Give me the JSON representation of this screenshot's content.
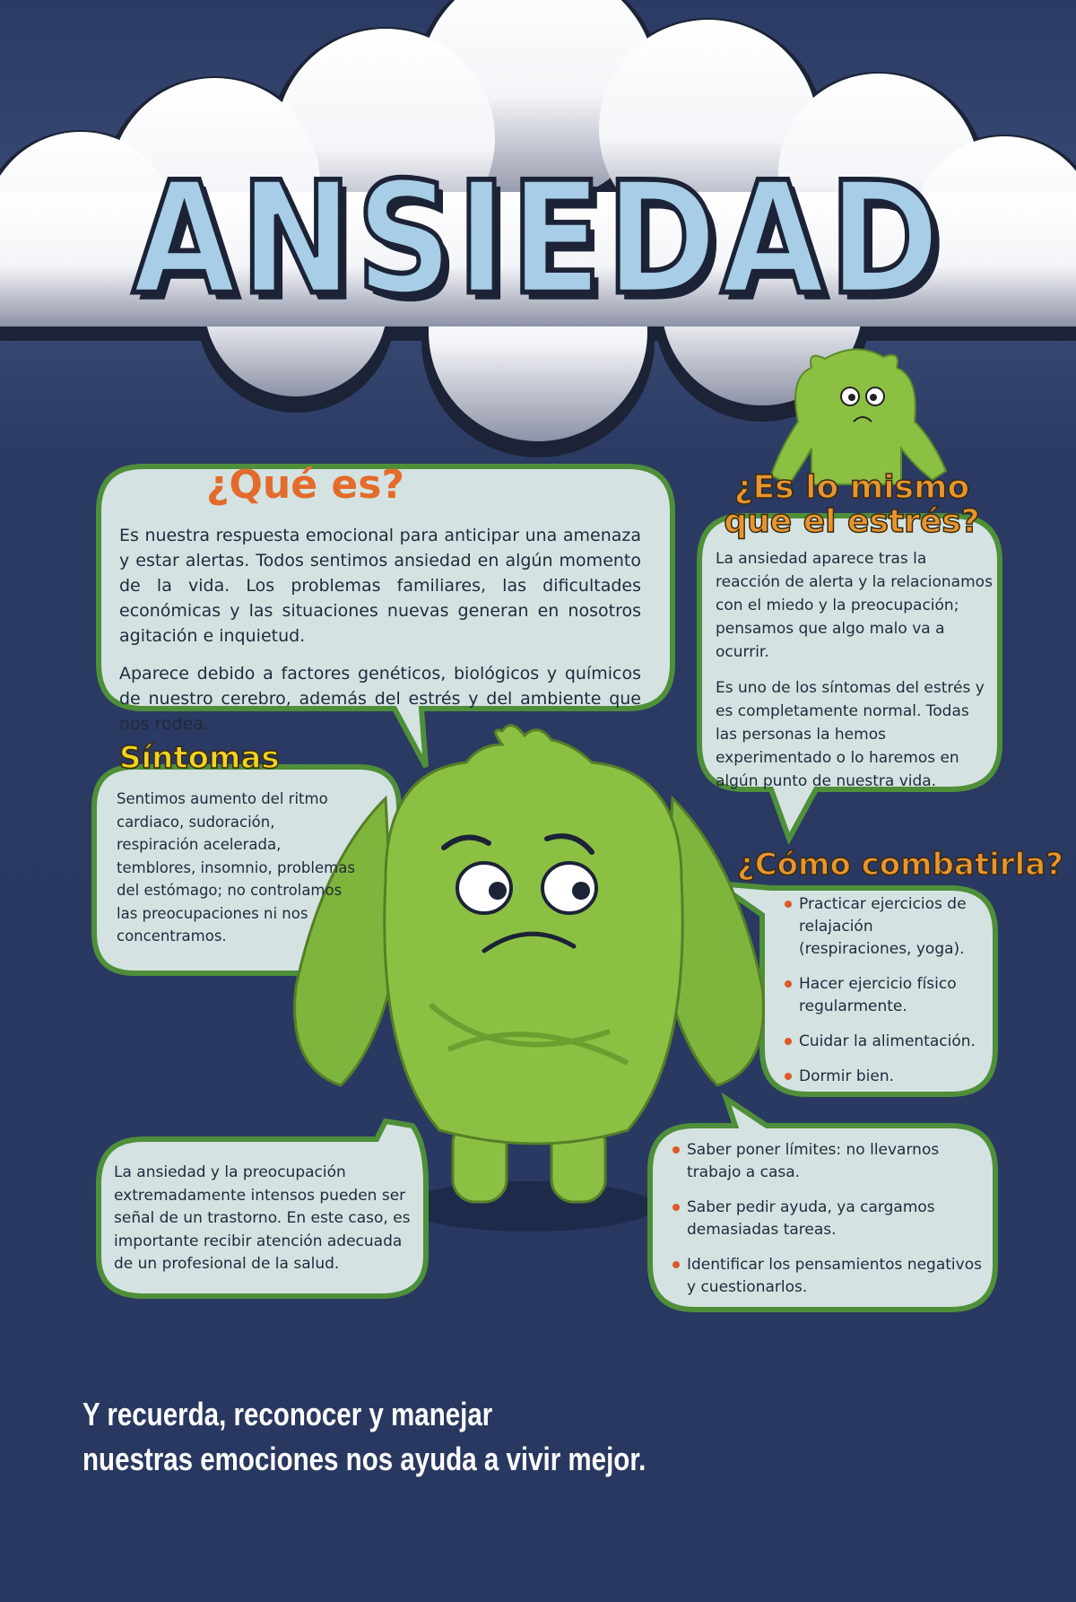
{
  "title": "ANSIEDAD",
  "que_es": {
    "heading": "¿Qué es?",
    "p1": "Es nuestra respuesta emocional para anticipar una amenaza y estar alertas. Todos sentimos ansiedad en algún momento de la vida. Los problemas familiares, las dificultades económicas y las situaciones nuevas generan en nosotros agitación e inquietud.",
    "p2": "Aparece debido a factores genéticos, biológicos y químicos de nuestro cerebro, además del estrés y del ambiente que nos rodea."
  },
  "estres": {
    "heading_line1": "¿Es lo mismo",
    "heading_line2": "que el estrés?",
    "p1": "La ansiedad aparece tras la reacción de alerta y la relacionamos con el miedo y la preocupación; pensamos que algo malo va a ocurrir.",
    "p2": "Es uno de los síntomas del estrés y es completamente normal. Todas las personas la hemos experimentado o lo haremos en algún punto de nuestra vida."
  },
  "sintomas": {
    "heading": "Síntomas",
    "text": "Sentimos aumento del ritmo cardiaco, sudoración, respiración acelerada, temblores, insomnio, problemas del estómago; no controlamos las preocupaciones ni nos concentramos."
  },
  "combatir": {
    "heading": "¿Cómo combatirla?",
    "items": [
      "Practicar ejercicios de relajación (respiraciones, yoga).",
      "Hacer ejercicio físico regularmente.",
      "Cuidar la alimentación.",
      "Dormir bien."
    ],
    "items2": [
      "Saber poner límites: no llevarnos trabajo a casa.",
      "Saber pedir ayuda, ya cargamos demasiadas tareas.",
      "Identificar los pensamientos negativos y cuestionarlos."
    ]
  },
  "trastorno": {
    "text": "La ansiedad y la preocupación extremadamente intensos pueden ser señal de un trastorno. En este caso, es importante recibir atención adecuada de un profesional de la salud."
  },
  "footer": {
    "line1": "Y recuerda, reconocer y manejar",
    "line2": "nuestras emociones nos ayuda a vivir mejor."
  },
  "colors": {
    "background": "#2b3b63",
    "bubble_fill": "#d4e3e1",
    "bubble_border": "#4f8f3a",
    "monster": "#8cc043",
    "title_fill": "#a8cde6"
  }
}
